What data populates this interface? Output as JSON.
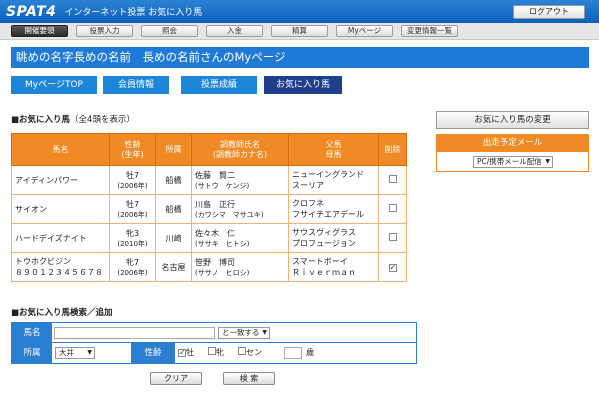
{
  "header": {
    "logo": "SPAT4",
    "site_title": "インターネット投票 お気に入り馬",
    "logout": "ログアウト"
  },
  "menu": [
    "開催要領",
    "投票入力",
    "照会",
    "入金",
    "精算",
    "Myページ",
    "変更情報一覧"
  ],
  "banner": "眺めの名字長めの名前　長めの名前さんのMyページ",
  "tabs": [
    "MyページTOP",
    "会員情報",
    "投票成績",
    "お気に入り馬"
  ],
  "favorites": {
    "title": "■お気に入り馬",
    "subtitle": "（全4頭を表示）",
    "headers": {
      "horse": "馬名",
      "age1": "性齢",
      "age2": "(生年)",
      "stable": "所属",
      "trainer1": "調教師氏名",
      "trainer2": "(調教師カナ名)",
      "sire": "父馬",
      "dam": "母馬",
      "delete": "削除"
    },
    "rows": [
      {
        "name": "アイディンパワー",
        "age": "牡7",
        "year": "(2006年)",
        "stable": "船橋",
        "trainer": "佐藤　賢二",
        "kana": "(サトウ　ケンジ)",
        "sire": "ニューイングランド",
        "dam": "スーリア",
        "checked": ""
      },
      {
        "name": "サイオン",
        "age": "牡7",
        "year": "(2006年)",
        "stable": "船橋",
        "trainer": "川島　正行",
        "kana": "(カワシマ　マサユキ)",
        "sire": "クロフネ",
        "dam": "フサイチエアデール",
        "checked": ""
      },
      {
        "name": "ハードデイズナイト",
        "age": "牝3",
        "year": "(2010年)",
        "stable": "川崎",
        "trainer": "佐々木　仁",
        "kana": "(ササキ　ヒトシ)",
        "sire": "サウスヴィグラス",
        "dam": "プロフュージョン",
        "checked": ""
      },
      {
        "name": "トウホクビジン",
        "name2": "８９０１２３４５６７８",
        "age": "牝7",
        "year": "(2006年)",
        "stable": "名古屋",
        "trainer": "笹野　博司",
        "kana": "(ササノ　ヒロシ)",
        "sire": "スマートボーイ",
        "dam": "Ｒｉｖｅｒｍａｎ",
        "checked": "✓"
      }
    ]
  },
  "sidebar": {
    "change_button": "お気に入り馬の変更",
    "mail_title": "出走予定メール",
    "mail_select": "PC/携帯メール配信"
  },
  "search": {
    "title": "■お気に入り馬検索／追加",
    "name_label": "馬名",
    "name_value": "",
    "match_select": "と一致する",
    "stable_label": "所属",
    "stable_select": "大井",
    "sex_label": "性齢",
    "sex_options": [
      {
        "label": "牡",
        "checked": "✓"
      },
      {
        "label": "牝",
        "checked": ""
      },
      {
        "label": "セン",
        "checked": ""
      }
    ],
    "age_value": "",
    "age_unit": "歳",
    "clear_button": "クリア",
    "search_button": "検 索"
  },
  "colors": {
    "blue": "#1f7ad7",
    "orange": "#f08a24",
    "dark_tab": "#1f3f8c"
  }
}
